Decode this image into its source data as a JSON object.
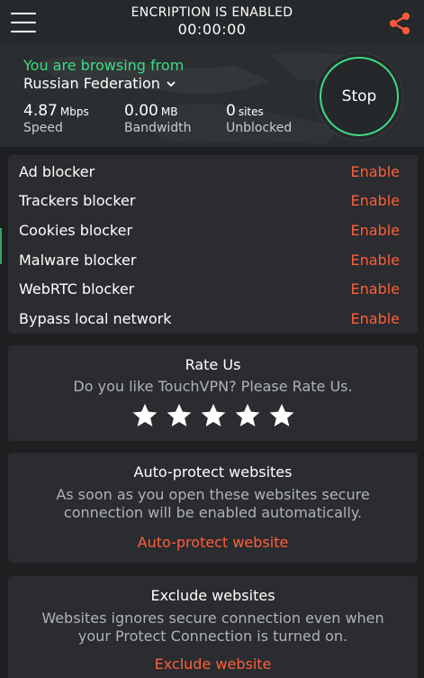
{
  "header": {
    "encryption_status": "ENCRIPTION IS ENABLED",
    "timer": "00:00:00",
    "menu_icon": "hamburger-menu-icon",
    "share_icon": "share-icon"
  },
  "connection": {
    "browsing_label": "You are browsing from",
    "country": "Russian Federation",
    "speed": {
      "value": "4.87",
      "unit": "Mbps",
      "label": "Speed"
    },
    "bandwidth": {
      "value": "0.00",
      "unit": "MB",
      "label": "Bandwidth"
    },
    "sites": {
      "value": "0",
      "unit": "sites",
      "label": "Unblocked"
    },
    "stop_label": "Stop"
  },
  "blockers": [
    {
      "name": "Ad blocker",
      "action": "Enable"
    },
    {
      "name": "Trackers blocker",
      "action": "Enable"
    },
    {
      "name": "Cookies blocker",
      "action": "Enable"
    },
    {
      "name": "Malware blocker",
      "action": "Enable"
    },
    {
      "name": "WebRTC blocker",
      "action": "Enable"
    },
    {
      "name": "Bypass local network",
      "action": "Enable"
    }
  ],
  "rate": {
    "title": "Rate Us",
    "text": "Do you like TouchVPN? Please Rate Us.",
    "stars": 5
  },
  "auto_protect": {
    "title": "Auto-protect websites",
    "text_line1": "As soon as you open these websites secure",
    "text_line2": "connection will be enabled automatically.",
    "link": "Auto-protect website"
  },
  "exclude": {
    "title": "Exclude websites",
    "text_line1": "Websites ignores secure connection even when",
    "text_line2": "your Protect Connection is turned on.",
    "link": "Exclude website"
  },
  "colors": {
    "accent_green": "#3ddc84",
    "action_orange": "#ff5e3a",
    "background": "#1d1f21",
    "card": "#2a2c2f"
  }
}
